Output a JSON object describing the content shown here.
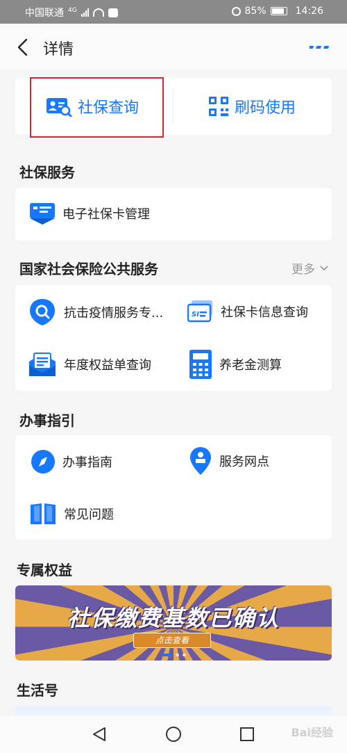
{
  "status_bar": {
    "carrier": "中国联通",
    "network": "4G",
    "battery": "85%",
    "time": "14:26"
  },
  "nav": {
    "title": "详情"
  },
  "top_actions": [
    {
      "label": "社保查询",
      "icon": "social-security-card-search-icon"
    },
    {
      "label": "刷码使用",
      "icon": "qr-code-icon"
    }
  ],
  "sections": {
    "social_service": {
      "title": "社保服务",
      "items": [
        {
          "label": "电子社保卡管理",
          "icon": "e-card-icon"
        }
      ]
    },
    "national_service": {
      "title": "国家社会保险公共服务",
      "more": "更多",
      "items": [
        {
          "label": "抗击疫情服务专...",
          "icon": "search-shield-icon"
        },
        {
          "label": "社保卡信息查询",
          "icon": "si-card-icon"
        },
        {
          "label": "年度权益单查询",
          "icon": "envelope-document-icon"
        },
        {
          "label": "养老金测算",
          "icon": "calculator-icon"
        }
      ]
    },
    "guide": {
      "title": "办事指引",
      "items": [
        {
          "label": "办事指南",
          "icon": "compass-icon"
        },
        {
          "label": "服务网点",
          "icon": "location-pin-icon"
        },
        {
          "label": "常见问题",
          "icon": "open-book-icon"
        }
      ]
    },
    "benefits": {
      "title": "专属权益",
      "banner": {
        "title": "社保缴费基数已确认",
        "button": "点击查看",
        "slide_count": 3,
        "active_slide": 1
      }
    },
    "life": {
      "title": "生活号"
    }
  },
  "watermark": "Bai经验",
  "colors": {
    "accent": "#1677ff",
    "highlight_box": "#d9232d",
    "banner_purple": "#6a5aa6",
    "banner_orange": "#e7a948"
  }
}
